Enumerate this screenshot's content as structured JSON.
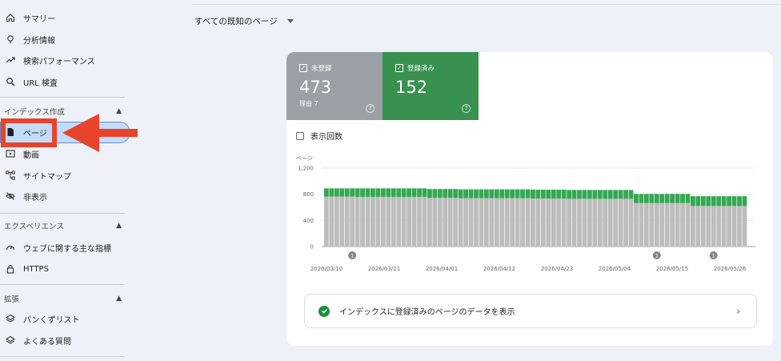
{
  "sidebar": {
    "top_items": [
      {
        "label": "サマリー",
        "icon": "home-icon"
      },
      {
        "label": "分析情報",
        "icon": "lightbulb-icon"
      },
      {
        "label": "検索パフォーマンス",
        "icon": "trend-icon"
      },
      {
        "label": "URL 検査",
        "icon": "search-icon"
      }
    ],
    "index_section": {
      "title": "インデックス作成",
      "items": [
        {
          "label": "ページ",
          "icon": "page-icon"
        },
        {
          "label": "動画",
          "icon": "video-icon"
        },
        {
          "label": "サイトマップ",
          "icon": "sitemap-icon"
        },
        {
          "label": "非表示",
          "icon": "eye-off-icon"
        }
      ]
    },
    "experience_section": {
      "title": "エクスペリエンス",
      "items": [
        {
          "label": "ウェブに関する主な指標",
          "icon": "gauge-icon"
        },
        {
          "label": "HTTPS",
          "icon": "lock-icon"
        }
      ]
    },
    "enhancement_section": {
      "title": "拡張",
      "items": [
        {
          "label": "パンくずリスト",
          "icon": "layers-icon"
        },
        {
          "label": "よくある質問",
          "icon": "layers-icon"
        }
      ]
    }
  },
  "filter": {
    "label": "すべての既知のページ"
  },
  "tiles": {
    "not_indexed": {
      "label": "未登録",
      "value": "473",
      "sub": "理由 7",
      "color": "#9aa0a6"
    },
    "indexed": {
      "label": "登録済み",
      "value": "152",
      "color": "#38914f"
    }
  },
  "impressions_label": "表示回数",
  "chart_data": {
    "type": "bar",
    "stacked": true,
    "ylabel": "ページ",
    "ylim": [
      0,
      1200
    ],
    "yticks": [
      "0",
      "400",
      "800",
      "1,200"
    ],
    "xticks": [
      "2026/03/10",
      "2026/03/21",
      "2026/04/01",
      "2026/04/12",
      "2026/04/23",
      "2026/05/04",
      "2026/05/15",
      "2026/05/26"
    ],
    "annotations": [
      {
        "label": "1",
        "index": 5
      },
      {
        "label": "1",
        "index": 64
      },
      {
        "label": "1",
        "index": 75
      }
    ],
    "series": [
      {
        "color": "#bdbdbd",
        "values": [
          765,
          765,
          765,
          765,
          765,
          765,
          760,
          760,
          760,
          760,
          760,
          760,
          760,
          760,
          760,
          760,
          760,
          760,
          760,
          760,
          745,
          745,
          745,
          745,
          745,
          745,
          740,
          740,
          740,
          740,
          740,
          740,
          740,
          740,
          740,
          740,
          740,
          740,
          740,
          740,
          735,
          735,
          735,
          735,
          735,
          735,
          735,
          730,
          730,
          730,
          730,
          730,
          730,
          730,
          730,
          730,
          730,
          730,
          730,
          730,
          665,
          665,
          665,
          665,
          665,
          665,
          665,
          665,
          665,
          665,
          665,
          620,
          620,
          620,
          620,
          620,
          620,
          620,
          620,
          620,
          620,
          620
        ]
      },
      {
        "color": "#34a853",
        "values": [
          125,
          125,
          125,
          125,
          125,
          125,
          130,
          130,
          130,
          130,
          130,
          130,
          130,
          130,
          130,
          130,
          130,
          130,
          130,
          130,
          135,
          135,
          135,
          135,
          135,
          135,
          135,
          135,
          135,
          135,
          135,
          135,
          135,
          135,
          135,
          135,
          135,
          135,
          135,
          135,
          135,
          135,
          135,
          135,
          135,
          135,
          135,
          135,
          135,
          135,
          135,
          135,
          135,
          135,
          135,
          135,
          135,
          135,
          135,
          135,
          140,
          140,
          140,
          140,
          140,
          140,
          140,
          140,
          140,
          140,
          140,
          150,
          150,
          150,
          150,
          150,
          150,
          150,
          150,
          150,
          150,
          150
        ]
      }
    ]
  },
  "view_data_link": "インデックスに登録済みのページのデータを表示"
}
